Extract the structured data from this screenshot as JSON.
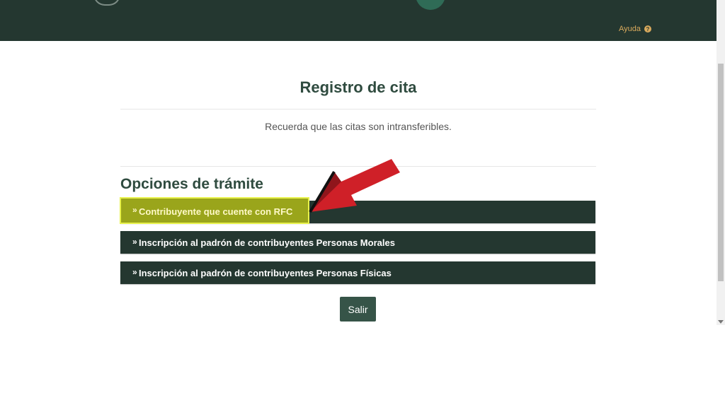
{
  "header": {
    "help_label": "Ayuda",
    "help_icon": "?"
  },
  "main": {
    "title": "Registro de cita",
    "subtitle": "Recuerda que las citas son intransferibles.",
    "section_title": "Opciones de trámite",
    "options": [
      {
        "label": "Contribuyente que cuente con RFC"
      },
      {
        "label": "Inscripción al padrón de contribuyentes Personas Morales"
      },
      {
        "label": "Inscripción al padrón de contribuyentes Personas Físicas"
      }
    ],
    "exit_label": "Salir"
  },
  "colors": {
    "header": "#243730",
    "accent": "#2f4b3f",
    "highlight": "#9aa51b",
    "arrow": "#cf2028"
  }
}
